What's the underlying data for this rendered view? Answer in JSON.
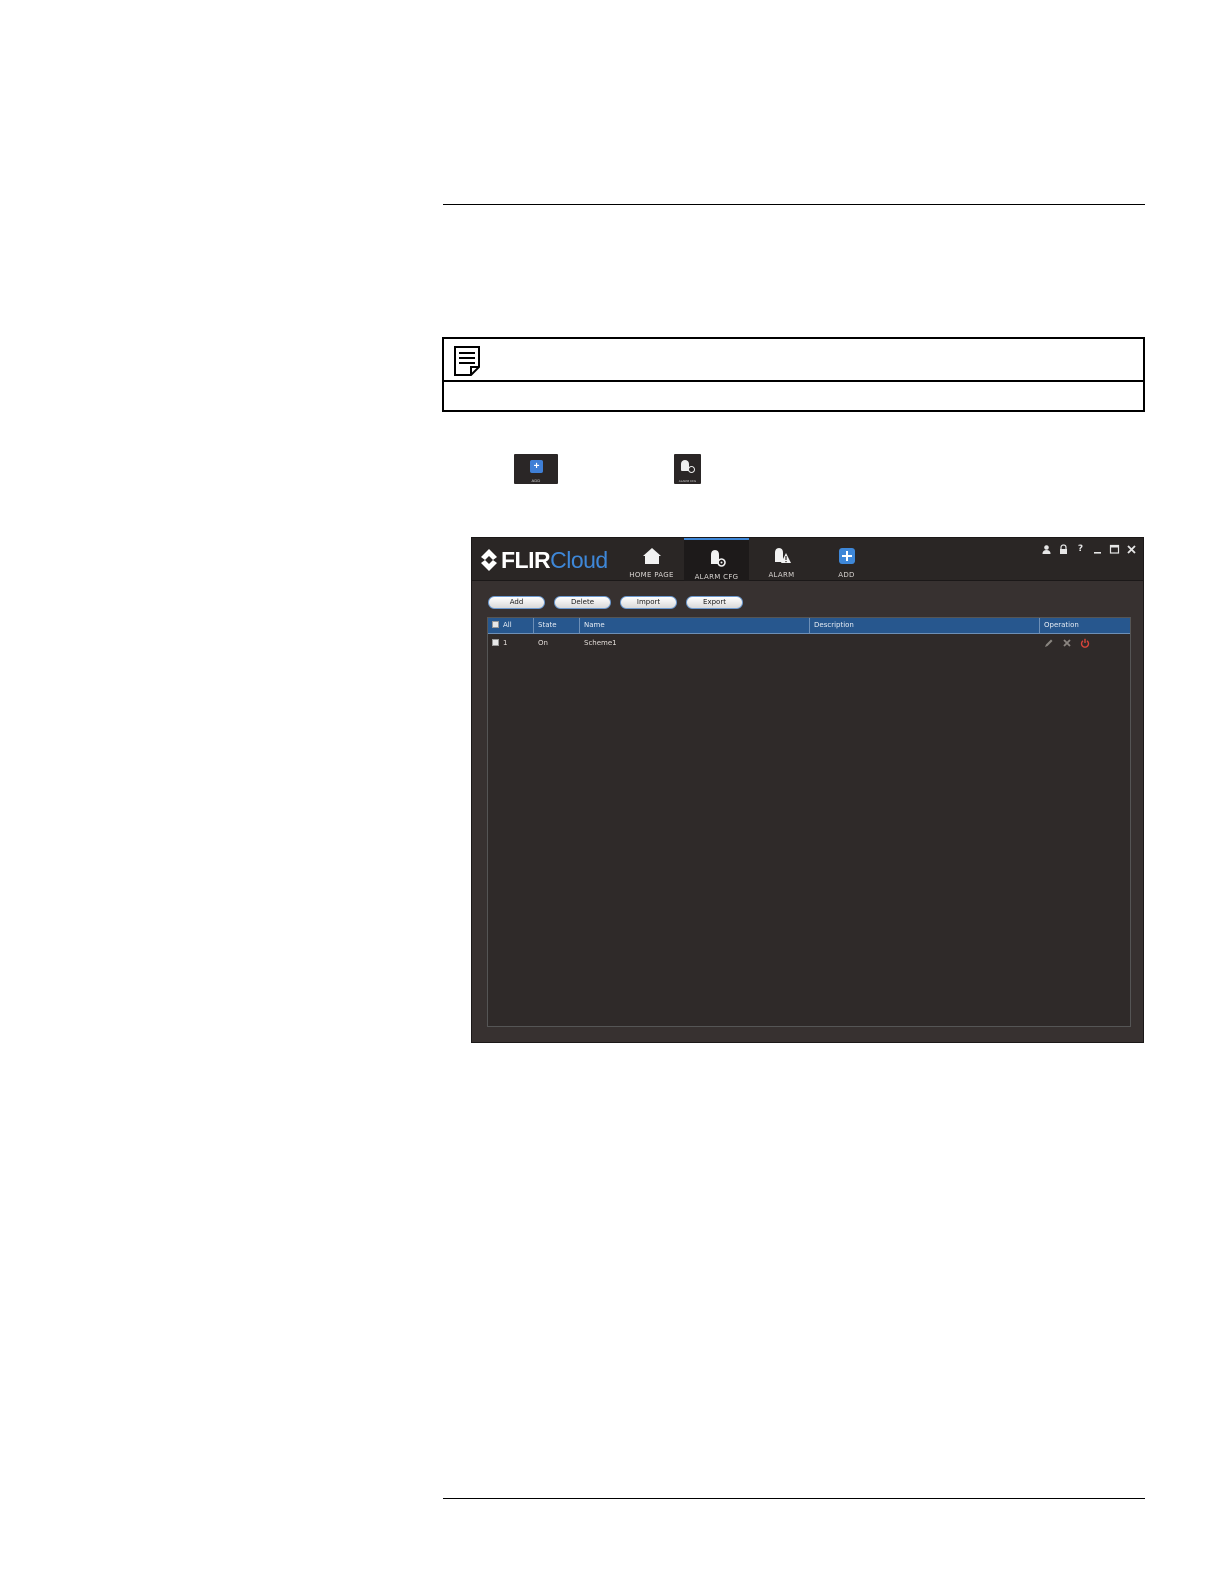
{
  "app": {
    "logo_primary": "FLIR",
    "logo_secondary": "Cloud",
    "nav": [
      {
        "label": "HOME PAGE",
        "icon": "home-icon"
      },
      {
        "label": "ALARM CFG",
        "icon": "alarm-config-icon"
      },
      {
        "label": "ALARM",
        "icon": "alarm-icon"
      },
      {
        "label": "ADD",
        "icon": "add-icon"
      }
    ],
    "active_tab": "ALARM CFG",
    "window_controls": [
      "user-icon",
      "lock-icon",
      "help-icon",
      "minimize-icon",
      "maximize-icon",
      "close-icon"
    ],
    "toolbar": {
      "add_label": "Add",
      "delete_label": "Delete",
      "import_label": "Import",
      "export_label": "Export"
    },
    "table": {
      "columns": {
        "all": "All",
        "state": "State",
        "name": "Name",
        "description": "Description",
        "operation": "Operation"
      },
      "rows": [
        {
          "index": "1",
          "state": "On",
          "name": "Scheme1",
          "description": "",
          "operations": [
            "edit-icon",
            "delete-icon",
            "power-icon"
          ]
        }
      ]
    }
  },
  "thumbnails": {
    "add_caption": "ADD",
    "alarm_cfg_caption": "ALARM CFG"
  },
  "colors": {
    "accent": "#3e87d8",
    "header_bg": "#27578e",
    "power_icon": "#d9453a",
    "window_bg": "#373130"
  }
}
